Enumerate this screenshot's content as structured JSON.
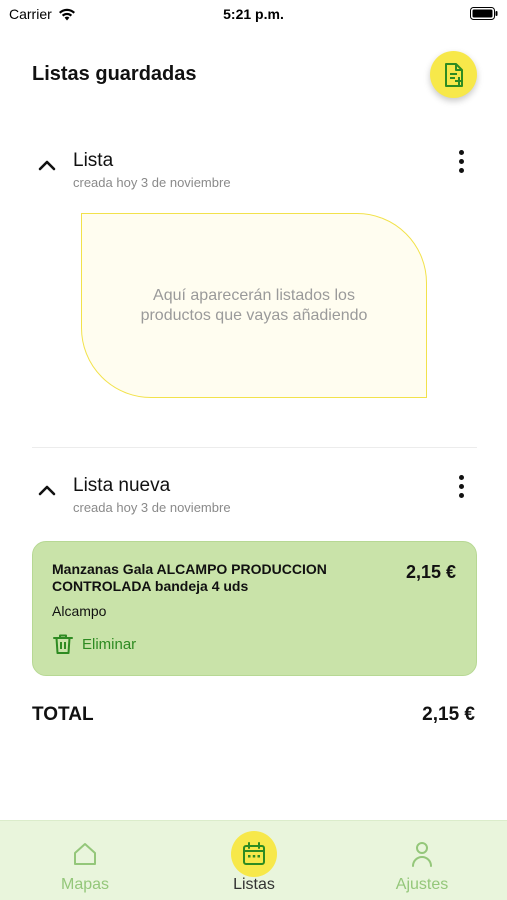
{
  "status_bar": {
    "carrier": "Carrier",
    "time": "5:21 p.m."
  },
  "header": {
    "title": "Listas guardadas",
    "new_list_icon": "add-document-icon"
  },
  "lists": [
    {
      "name": "Lista",
      "created": "creada hoy 3 de noviembre",
      "empty_message": "Aquí aparecerán listados los productos que vayas añadiendo"
    },
    {
      "name": "Lista nueva",
      "created": "creada hoy 3 de noviembre",
      "products": [
        {
          "name": "Manzanas Gala ALCAMPO PRODUCCION CONTROLADA bandeja 4 uds",
          "price": "2,15 €",
          "store": "Alcampo",
          "delete_label": "Eliminar"
        }
      ]
    }
  ],
  "total": {
    "label": "TOTAL",
    "value": "2,15 €"
  },
  "bottom_nav": [
    {
      "label": "Mapas",
      "icon": "home-icon",
      "active": false
    },
    {
      "label": "Listas",
      "icon": "calendar-icon",
      "active": true
    },
    {
      "label": "Ajustes",
      "icon": "user-icon",
      "active": false
    }
  ],
  "colors": {
    "accent_yellow": "#f7e84a",
    "card_green": "#c9e3a9",
    "delete_green": "#2e8b22",
    "nav_background": "#e9f5dc",
    "nav_inactive": "#94c77a"
  }
}
